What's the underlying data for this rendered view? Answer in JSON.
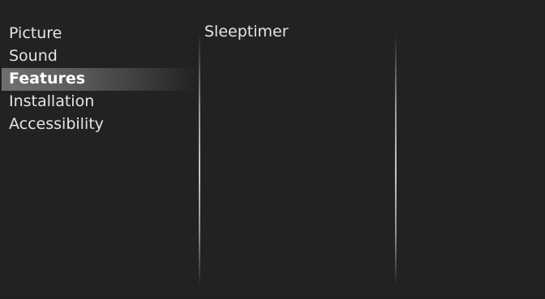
{
  "menu": {
    "items": [
      {
        "label": "Picture"
      },
      {
        "label": "Sound"
      },
      {
        "label": "Features"
      },
      {
        "label": "Installation"
      },
      {
        "label": "Accessibility"
      }
    ],
    "selected": "Features"
  },
  "submenu": {
    "items": [
      {
        "label": "Sleeptimer"
      }
    ]
  }
}
